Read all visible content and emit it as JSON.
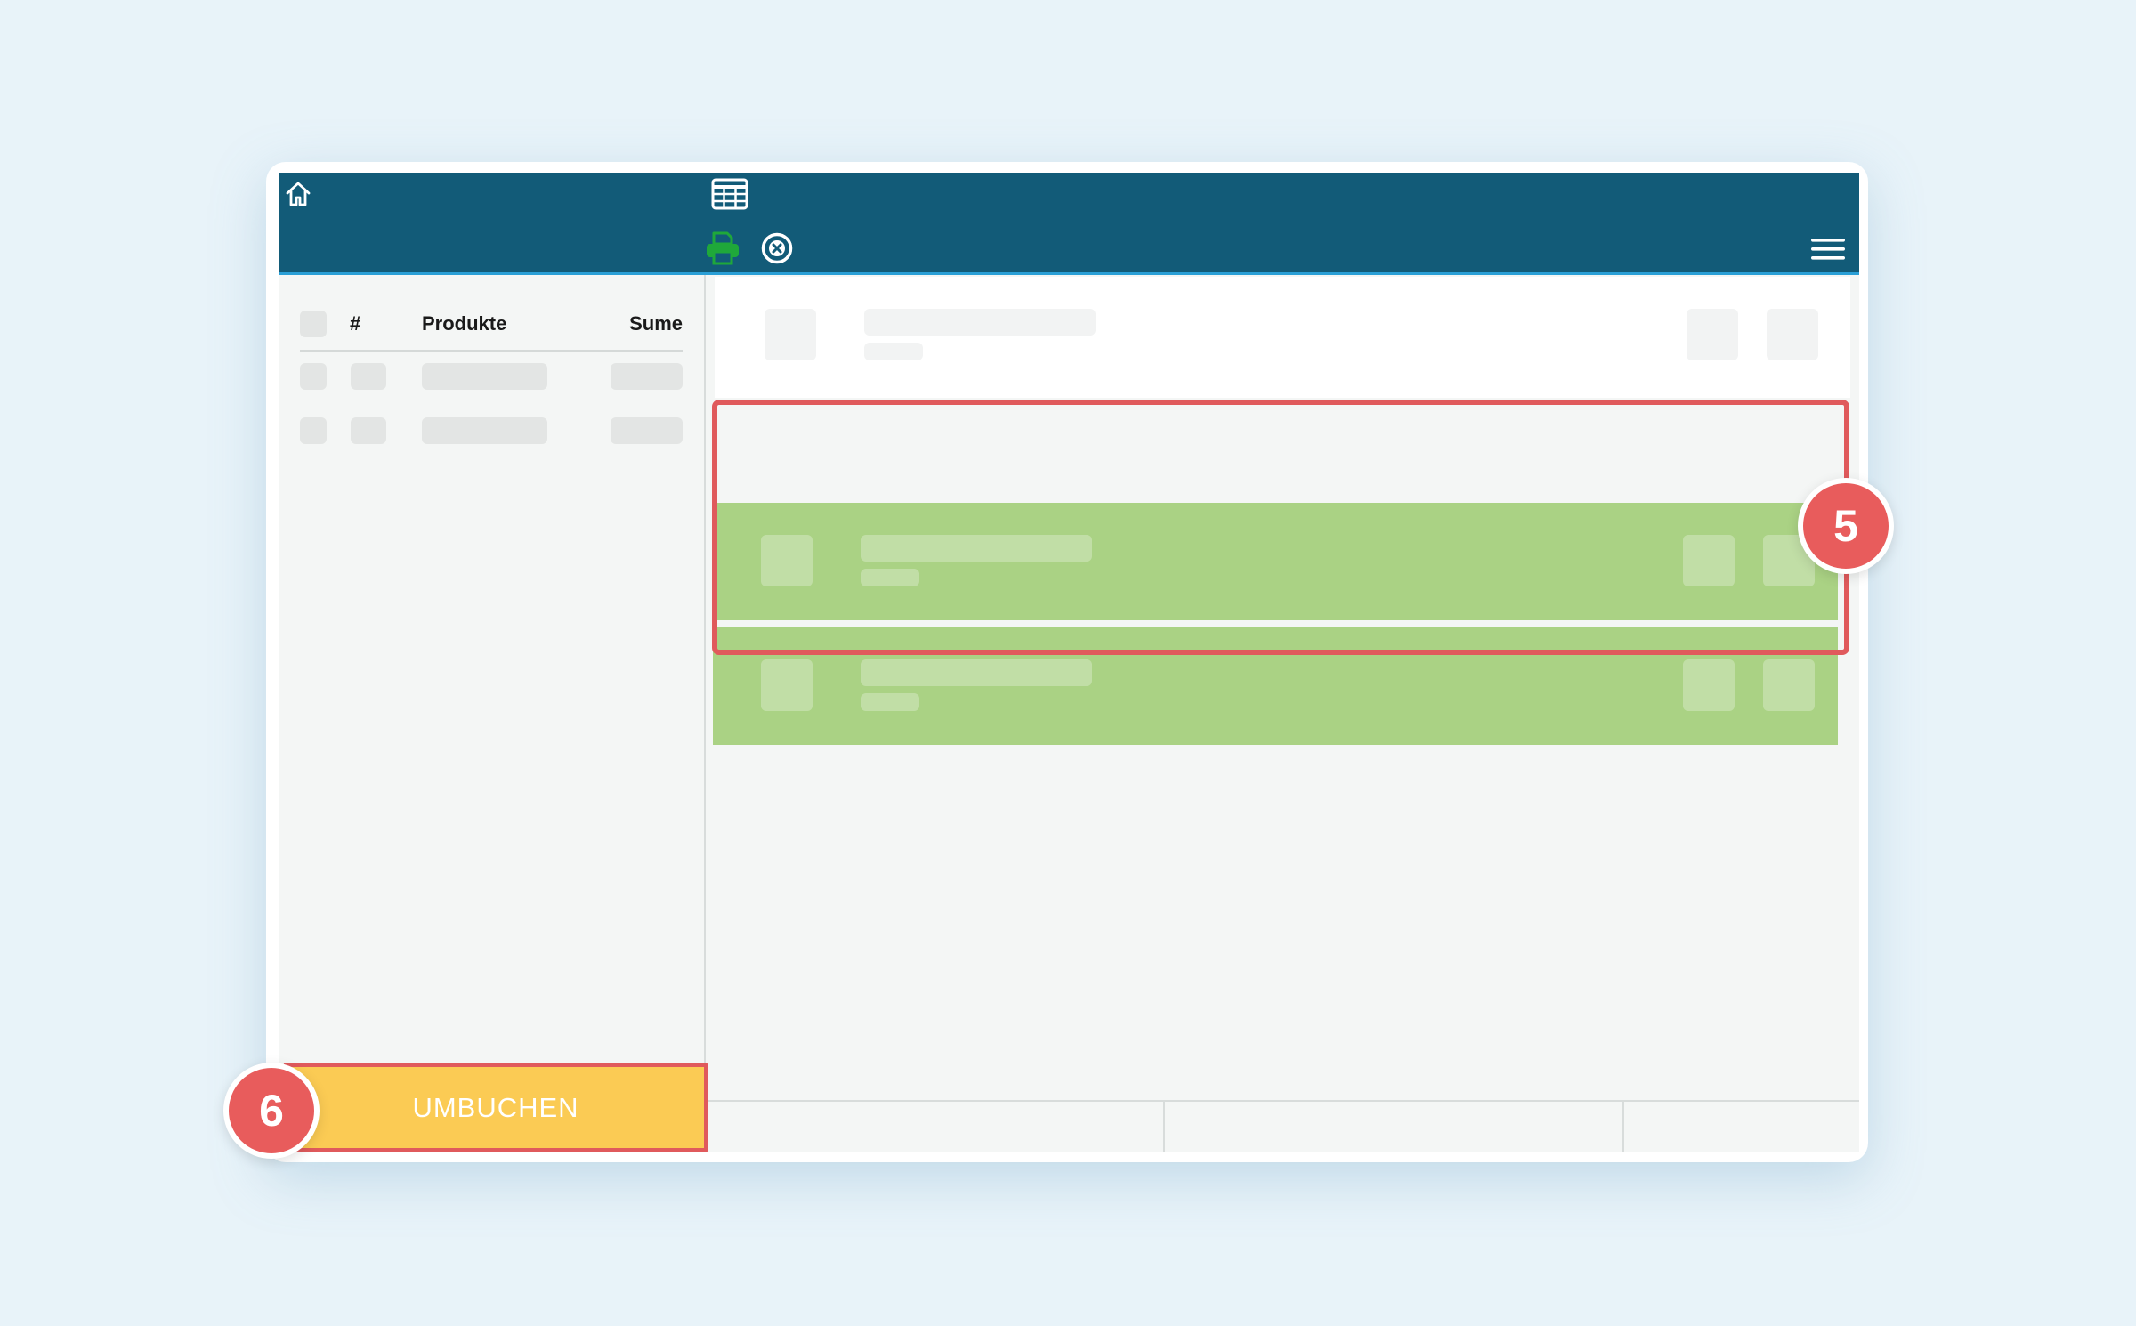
{
  "sidebar": {
    "columns": {
      "hash": "#",
      "products": "Produkte",
      "sum": "Sume"
    }
  },
  "actions": {
    "rebook_label": "UMBUCHEN"
  },
  "annotations": {
    "step_5": "5",
    "step_6": "6"
  },
  "icons": {
    "home": "home-icon",
    "table": "table-grid-icon",
    "print": "printer-icon",
    "close": "close-circle-icon",
    "menu": "hamburger-menu-icon"
  },
  "colors": {
    "header": "#125b78",
    "header_accent": "#2a9fd6",
    "selected_rows": "#aad284",
    "primary_button": "#fbcb54",
    "annotation": "#e05a5c",
    "print_icon": "#1fa83a"
  }
}
